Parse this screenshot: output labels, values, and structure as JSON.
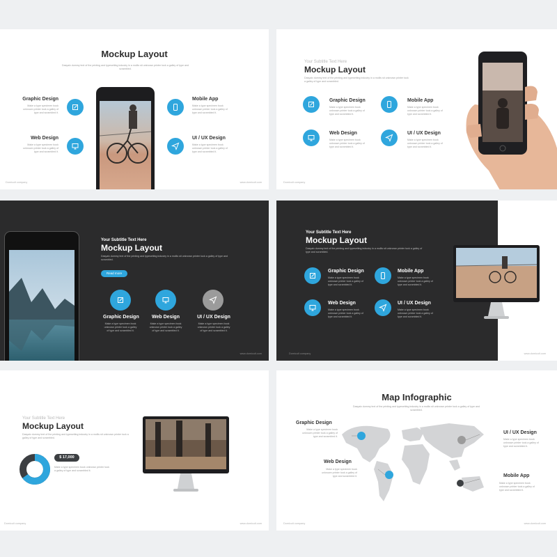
{
  "colors": {
    "accent": "#2fa6dd",
    "dark_bg": "#2b2b2c",
    "gray_dot": "#9b9b9b"
  },
  "common": {
    "lorem_short": "Dasyaix dummy text of the printing and typesetting industry in a mollis sit unknown printer tock a galley of type and scrambled.",
    "lorem_desc": "Make a type specimen book unknown printer took a galley of type and scrambled it.",
    "footer_left": "Domicult company",
    "footer_right": "www.domicult.com"
  },
  "slide1": {
    "title": "Mockup Layout",
    "items": [
      {
        "label": "Graphic Design",
        "icon": "pencil-icon"
      },
      {
        "label": "Web Design",
        "icon": "monitor-icon"
      },
      {
        "label": "Mobile App",
        "icon": "phone-icon"
      },
      {
        "label": "UI / UX Design",
        "icon": "paper-plane-icon"
      }
    ]
  },
  "slide2": {
    "subtitle": "Your Subtitle Text Here",
    "title": "Mockup Layout",
    "items": [
      {
        "label": "Graphic Design",
        "icon": "pencil-icon"
      },
      {
        "label": "Mobile App",
        "icon": "phone-icon"
      },
      {
        "label": "Web Design",
        "icon": "monitor-icon"
      },
      {
        "label": "UI / UX Design",
        "icon": "paper-plane-icon"
      }
    ]
  },
  "slide3": {
    "subtitle": "Your Subtitle Text Here",
    "title": "Mockup Layout",
    "button": "Read more",
    "items": [
      {
        "label": "Graphic Design",
        "icon": "pencil-icon"
      },
      {
        "label": "Web Design",
        "icon": "monitor-icon"
      },
      {
        "label": "UI / UX Design",
        "icon": "paper-plane-icon"
      }
    ]
  },
  "slide4": {
    "subtitle": "Your Subtitle Text Here",
    "title": "Mockup Layout",
    "items": [
      {
        "label": "Graphic Design",
        "icon": "pencil-icon"
      },
      {
        "label": "Mobile App",
        "icon": "phone-icon"
      },
      {
        "label": "Web Design",
        "icon": "monitor-icon"
      },
      {
        "label": "UI / UX Design",
        "icon": "paper-plane-icon"
      }
    ]
  },
  "slide5": {
    "subtitle": "Your Subtitle Text Here",
    "title": "Mockup Layout",
    "badge": "$ 17,000",
    "donut_fraction": 0.65
  },
  "slide6": {
    "title": "Map Infographic",
    "items": [
      {
        "label": "Graphic Design"
      },
      {
        "label": "Web Design"
      },
      {
        "label": "UI / UX Design"
      },
      {
        "label": "Mobile App"
      }
    ]
  }
}
